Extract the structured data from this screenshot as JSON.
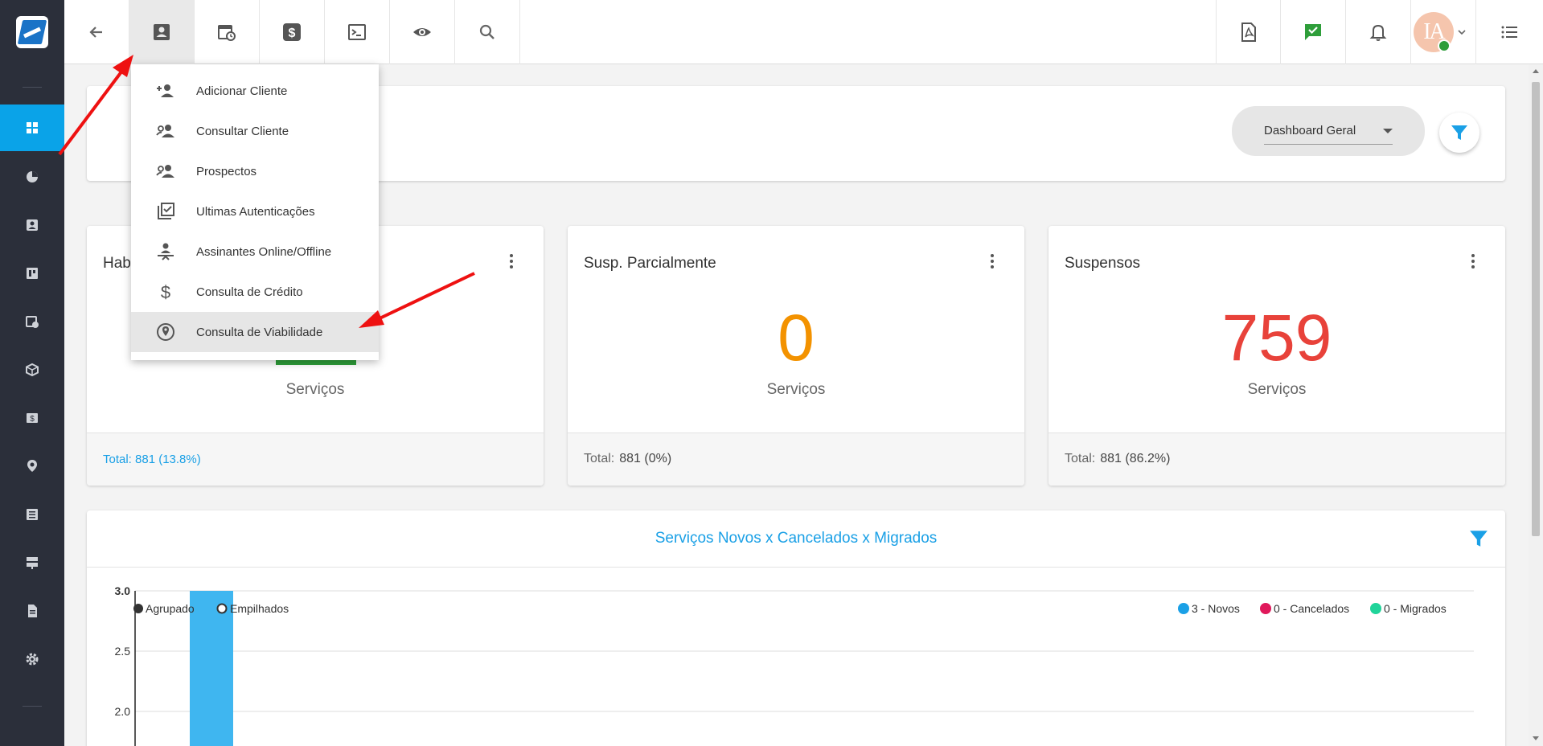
{
  "brand": {
    "accent": "#0aa3e8",
    "success": "#2e9e3a",
    "warning": "#f39200",
    "danger": "#e8423a",
    "link": "#1aa0e6"
  },
  "sidebar": {
    "items": [
      {
        "icon": "dashboard-icon",
        "active": true
      },
      {
        "icon": "pie-chart-icon"
      },
      {
        "icon": "contact-icon"
      },
      {
        "icon": "board-icon"
      },
      {
        "icon": "calendar-clock-icon"
      },
      {
        "icon": "box-icon"
      },
      {
        "icon": "money-icon"
      },
      {
        "icon": "location-icon"
      },
      {
        "icon": "list-icon"
      },
      {
        "icon": "server-icon"
      },
      {
        "icon": "document-icon"
      },
      {
        "icon": "gear-icon"
      }
    ]
  },
  "topbar": {
    "left_buttons": [
      "back-arrow-icon",
      "contact-icon",
      "calendar-clock-icon",
      "dollar-icon",
      "terminal-icon",
      "eye-icon",
      "search-icon"
    ],
    "right_buttons": [
      "pdf-icon",
      "chat-check-icon",
      "bell-icon",
      "avatar",
      "menu-list-icon"
    ],
    "avatar_initials": "IA"
  },
  "client_menu": {
    "items": [
      {
        "label": "Adicionar Cliente",
        "icon": "person-add-icon"
      },
      {
        "label": "Consultar Cliente",
        "icon": "people-search-icon"
      },
      {
        "label": "Prospectos",
        "icon": "people-icon"
      },
      {
        "label": "Ultimas Autenticações",
        "icon": "checklist-icon"
      },
      {
        "label": "Assinantes Online/Offline",
        "icon": "person-online-icon"
      },
      {
        "label": "Consulta de Crédito",
        "icon": "dollar-icon"
      },
      {
        "label": "Consulta de Viabilidade",
        "icon": "location-pin-icon",
        "hover": true
      }
    ]
  },
  "dashboard_selector": {
    "value": "Dashboard Geral"
  },
  "stats": [
    {
      "title": "Hab",
      "unit": "Serviços",
      "footer_text": "Total: 881 (13.8%)"
    },
    {
      "title": "Susp. Parcialmente",
      "value": "0",
      "unit": "Serviços",
      "footer_label": "Total:",
      "footer_value": "881 (0%)"
    },
    {
      "title": "Suspensos",
      "value": "759",
      "unit": "Serviços",
      "footer_label": "Total:",
      "footer_value": "881 (86.2%)"
    }
  ],
  "chart_section": {
    "title": "Serviços Novos x Cancelados x Migrados",
    "modes": [
      "Agrupado",
      "Empilhados"
    ],
    "legend": [
      {
        "label": "3 - Novos",
        "color": "#1aa0e6"
      },
      {
        "label": "0 - Cancelados",
        "color": "#e0195b"
      },
      {
        "label": "0 - Migrados",
        "color": "#20d49a"
      }
    ]
  },
  "chart_data": {
    "type": "bar",
    "series": [
      {
        "name": "3 - Novos",
        "values": [
          3
        ]
      },
      {
        "name": "0 - Cancelados",
        "values": [
          0
        ]
      },
      {
        "name": "0 - Migrados",
        "values": [
          0
        ]
      }
    ],
    "y_ticks": [
      "3.0",
      "2.5",
      "2.0"
    ],
    "ylim": [
      2.0,
      3.0
    ],
    "grid": true,
    "legend_position": "top-right"
  }
}
